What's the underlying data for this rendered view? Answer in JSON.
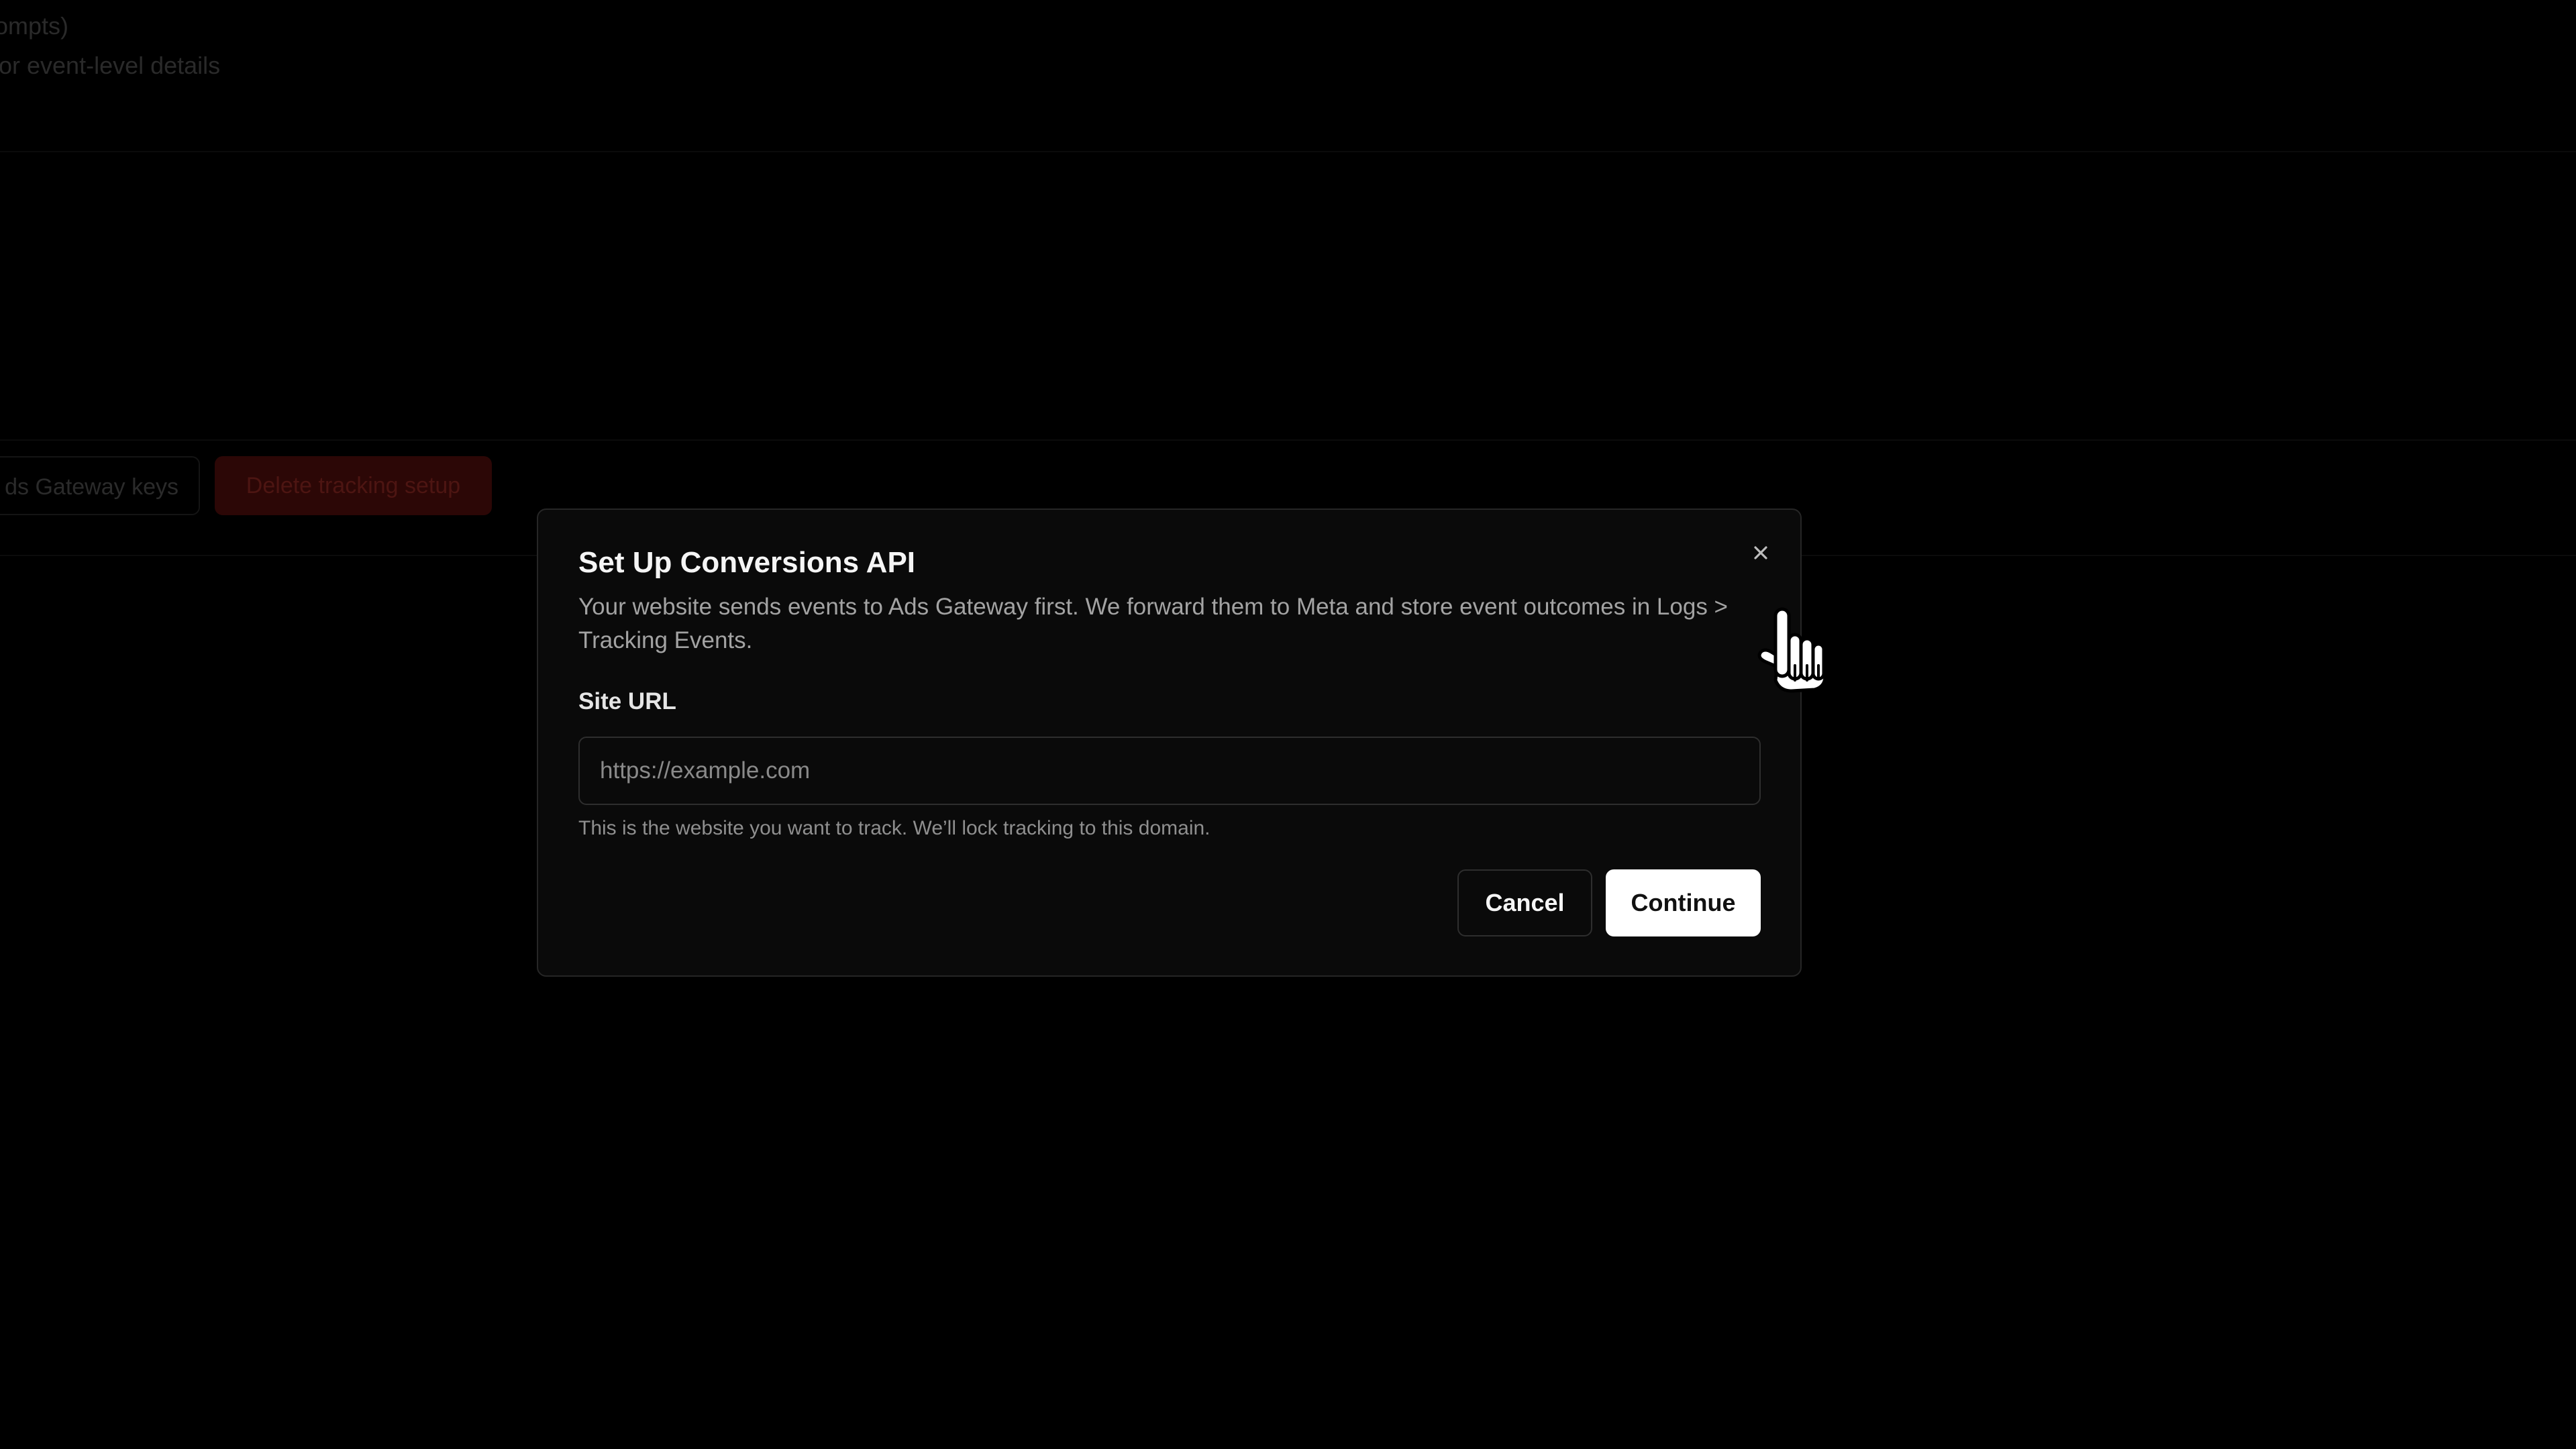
{
  "background": {
    "text_line_1": "prompts)",
    "text_line_2": "s for event-level details",
    "keys_button_label": "ds Gateway keys",
    "delete_button_label": "Delete tracking setup"
  },
  "modal": {
    "title": "Set Up Conversions API",
    "description": "Your website sends events to Ads Gateway first. We forward them to Meta and store event outcomes in Logs > Tracking Events.",
    "site_url_label": "Site URL",
    "site_url_value": "",
    "site_url_placeholder": "https://example.com",
    "helper_text": "This is the website you want to track. We’ll lock tracking to this domain.",
    "cancel_label": "Cancel",
    "continue_label": "Continue",
    "close_icon": "close-icon"
  },
  "cursor": {
    "icon": "pointer-hand-icon"
  },
  "colors": {
    "background": "#000000",
    "modal_background": "#0a0a0a",
    "modal_border": "#262626",
    "primary_button": "#ffffff",
    "danger_button_dimmed": "#2c0706"
  }
}
